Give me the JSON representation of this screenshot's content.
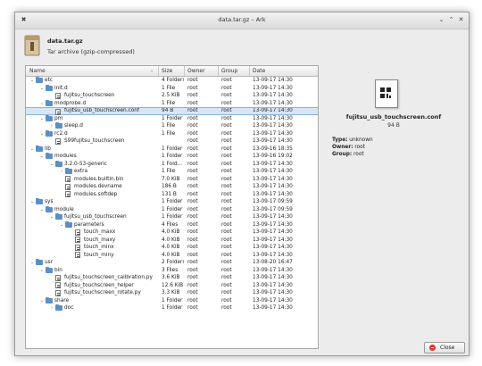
{
  "window": {
    "title": "data.tar.gz – Ark"
  },
  "archive": {
    "name": "data.tar.gz",
    "type": "Tar archive (gzip-compressed)"
  },
  "columns": [
    "Name",
    "Size",
    "Owner",
    "Group",
    "Date"
  ],
  "rows": [
    {
      "name": "etc",
      "size": "4 Folders",
      "owner": "root",
      "group": "root",
      "date": "13-09-17 14:30",
      "depth": 0,
      "kind": "folder",
      "exp": "open"
    },
    {
      "name": "init.d",
      "size": "1 File",
      "owner": "root",
      "group": "root",
      "date": "13-09-17 14:30",
      "depth": 1,
      "kind": "folder",
      "exp": "open"
    },
    {
      "name": "fujitsu_touchscreen",
      "size": "2.5 KiB",
      "owner": "root",
      "group": "root",
      "date": "13-09-17 14:30",
      "depth": 2,
      "kind": "file",
      "exp": ""
    },
    {
      "name": "modprobe.d",
      "size": "1 File",
      "owner": "root",
      "group": "root",
      "date": "13-09-17 14:30",
      "depth": 1,
      "kind": "folder",
      "exp": "open"
    },
    {
      "name": "fujitsu_usb_touchscreen.conf",
      "size": "94 B",
      "owner": "root",
      "group": "root",
      "date": "13-09-17 14:30",
      "depth": 2,
      "kind": "file",
      "exp": "",
      "selected": true
    },
    {
      "name": "pm",
      "size": "1 Folder",
      "owner": "root",
      "group": "root",
      "date": "13-09-17 14:30",
      "depth": 1,
      "kind": "folder",
      "exp": "open"
    },
    {
      "name": "sleep.d",
      "size": "1 File",
      "owner": "root",
      "group": "root",
      "date": "13-09-17 14:30",
      "depth": 2,
      "kind": "folder",
      "exp": "closed"
    },
    {
      "name": "rc2.d",
      "size": "1 File",
      "owner": "root",
      "group": "root",
      "date": "13-09-17 14:30",
      "depth": 1,
      "kind": "folder",
      "exp": "open"
    },
    {
      "name": "S99fujitsu_touchscreen",
      "size": "",
      "owner": "root",
      "group": "root",
      "date": "13-09-17 14:30",
      "depth": 2,
      "kind": "file",
      "exp": ""
    },
    {
      "name": "lib",
      "size": "1 Folder",
      "owner": "root",
      "group": "root",
      "date": "13-09-16 18:35",
      "depth": 0,
      "kind": "folder",
      "exp": "open"
    },
    {
      "name": "modules",
      "size": "1 Folder",
      "owner": "root",
      "group": "root",
      "date": "13-09-16 19:02",
      "depth": 1,
      "kind": "folder",
      "exp": "open"
    },
    {
      "name": "3.2.0-53-generic",
      "size": "1 Fold...",
      "owner": "root",
      "group": "root",
      "date": "13-09-17 14:30",
      "depth": 2,
      "kind": "folder",
      "exp": "open"
    },
    {
      "name": "extra",
      "size": "1 File",
      "owner": "root",
      "group": "root",
      "date": "13-09-17 14:30",
      "depth": 3,
      "kind": "folder",
      "exp": "closed"
    },
    {
      "name": "modules.builtin.bin",
      "size": "7.0 KiB",
      "owner": "root",
      "group": "root",
      "date": "13-09-17 14:30",
      "depth": 3,
      "kind": "file",
      "exp": ""
    },
    {
      "name": "modules.devname",
      "size": "186 B",
      "owner": "root",
      "group": "root",
      "date": "13-09-17 14:30",
      "depth": 3,
      "kind": "file",
      "exp": ""
    },
    {
      "name": "modules.softdep",
      "size": "131 B",
      "owner": "root",
      "group": "root",
      "date": "13-09-17 14:30",
      "depth": 3,
      "kind": "file",
      "exp": ""
    },
    {
      "name": "sys",
      "size": "1 Folder",
      "owner": "root",
      "group": "root",
      "date": "13-09-17 09:59",
      "depth": 0,
      "kind": "folder",
      "exp": "open"
    },
    {
      "name": "module",
      "size": "1 Folder",
      "owner": "root",
      "group": "root",
      "date": "13-09-17 09:59",
      "depth": 1,
      "kind": "folder",
      "exp": "open"
    },
    {
      "name": "fujitsu_usb_touchscreen",
      "size": "1 Folder",
      "owner": "root",
      "group": "root",
      "date": "13-09-17 14:30",
      "depth": 2,
      "kind": "folder",
      "exp": "open"
    },
    {
      "name": "parameters",
      "size": "4 Files",
      "owner": "root",
      "group": "root",
      "date": "13-09-17 14:30",
      "depth": 3,
      "kind": "folder",
      "exp": "open"
    },
    {
      "name": "touch_maxx",
      "size": "4.0 KiB",
      "owner": "root",
      "group": "root",
      "date": "13-09-17 14:30",
      "depth": 4,
      "kind": "file",
      "exp": ""
    },
    {
      "name": "touch_maxy",
      "size": "4.0 KiB",
      "owner": "root",
      "group": "root",
      "date": "13-09-17 14:30",
      "depth": 4,
      "kind": "file",
      "exp": ""
    },
    {
      "name": "touch_minx",
      "size": "4.0 KiB",
      "owner": "root",
      "group": "root",
      "date": "13-09-17 14:30",
      "depth": 4,
      "kind": "file",
      "exp": ""
    },
    {
      "name": "touch_miny",
      "size": "4.0 KiB",
      "owner": "root",
      "group": "root",
      "date": "13-09-17 14:30",
      "depth": 4,
      "kind": "file",
      "exp": ""
    },
    {
      "name": "usr",
      "size": "2 Folders",
      "owner": "root",
      "group": "root",
      "date": "13-08-20 16:47",
      "depth": 0,
      "kind": "folder",
      "exp": "open"
    },
    {
      "name": "bin",
      "size": "3 Files",
      "owner": "root",
      "group": "root",
      "date": "13-09-17 14:30",
      "depth": 1,
      "kind": "folder",
      "exp": "open"
    },
    {
      "name": "fujitsu_touchscreen_calibration.py",
      "size": "3.6 KiB",
      "owner": "root",
      "group": "root",
      "date": "13-09-17 14:30",
      "depth": 2,
      "kind": "file",
      "exp": ""
    },
    {
      "name": "fujitsu_touchscreen_helper",
      "size": "12.6 KiB",
      "owner": "root",
      "group": "root",
      "date": "13-09-17 14:30",
      "depth": 2,
      "kind": "file",
      "exp": ""
    },
    {
      "name": "fujitsu_touchscreen_rotate.py",
      "size": "3.3 KiB",
      "owner": "root",
      "group": "root",
      "date": "13-09-17 14:30",
      "depth": 2,
      "kind": "file",
      "exp": ""
    },
    {
      "name": "share",
      "size": "1 Folder",
      "owner": "root",
      "group": "root",
      "date": "13-09-17 14:30",
      "depth": 1,
      "kind": "folder",
      "exp": "open"
    },
    {
      "name": "doc",
      "size": "1 Folder",
      "owner": "root",
      "group": "root",
      "date": "13-09-17 14:30",
      "depth": 2,
      "kind": "folder",
      "exp": "closed"
    }
  ],
  "details": {
    "name": "fujitsu_usb_touchscreen.conf",
    "size": "94 B",
    "type_label": "Type:",
    "type_value": "unknown",
    "owner_label": "Owner:",
    "owner_value": "root",
    "group_label": "Group:",
    "group_value": "root"
  },
  "buttons": {
    "close": "Close"
  },
  "icons": [
    "app-icon",
    "minimize-icon",
    "maximize-icon",
    "close-window-icon",
    "folder-icon",
    "file-icon",
    "close-icon"
  ],
  "colors": {
    "folder": "#5b8fc9",
    "selection": "#d6e6f6",
    "close_icon": "#d9382c"
  }
}
